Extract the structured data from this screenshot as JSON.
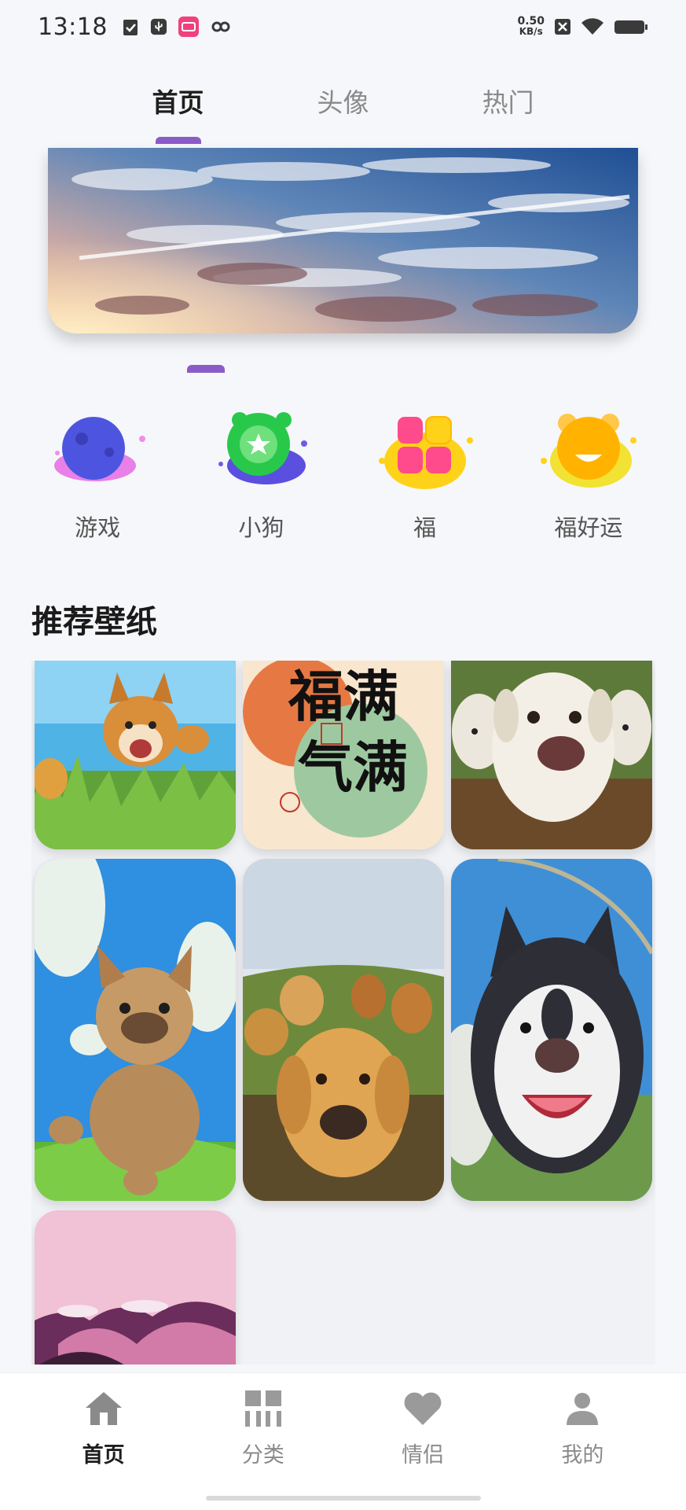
{
  "status_bar": {
    "time": "13:18",
    "net_speed_value": "0.50",
    "net_speed_unit": "KB/s",
    "left_icons": [
      "shield-check-icon",
      "usb-debug-icon",
      "app-notification-icon",
      "link-icon"
    ],
    "right_icons": [
      "no-sim-icon",
      "wifi-icon",
      "battery-icon"
    ]
  },
  "top_tabs": [
    {
      "label": "首页",
      "active": true
    },
    {
      "label": "头像",
      "active": false
    },
    {
      "label": "热门",
      "active": false
    }
  ],
  "quick_categories": [
    {
      "label": "游戏",
      "icon": "planet-icon"
    },
    {
      "label": "小狗",
      "icon": "star-badge-icon"
    },
    {
      "label": "福",
      "icon": "grid-blocks-icon"
    },
    {
      "label": "福好运",
      "icon": "bear-icon"
    }
  ],
  "section": {
    "title": "推荐壁纸"
  },
  "wallpapers": [
    {
      "caption": "",
      "calligraphy": ""
    },
    {
      "caption": "",
      "calligraphy": "福满气满"
    },
    {
      "caption": "",
      "calligraphy": ""
    },
    {
      "caption": "",
      "calligraphy": ""
    },
    {
      "caption": "",
      "calligraphy": ""
    },
    {
      "caption": "",
      "calligraphy": ""
    },
    {
      "caption": "",
      "calligraphy": ""
    }
  ],
  "bottom_nav": [
    {
      "label": "首页",
      "icon": "home-icon",
      "active": true
    },
    {
      "label": "分类",
      "icon": "category-icon",
      "active": false
    },
    {
      "label": "情侣",
      "icon": "heart-icon",
      "active": false
    },
    {
      "label": "我的",
      "icon": "person-icon",
      "active": false
    }
  ],
  "colors": {
    "accent": "#8b5cc7",
    "background": "#f6f7fa",
    "text_primary": "#1e1e1e",
    "text_secondary": "#8a8a8a"
  }
}
